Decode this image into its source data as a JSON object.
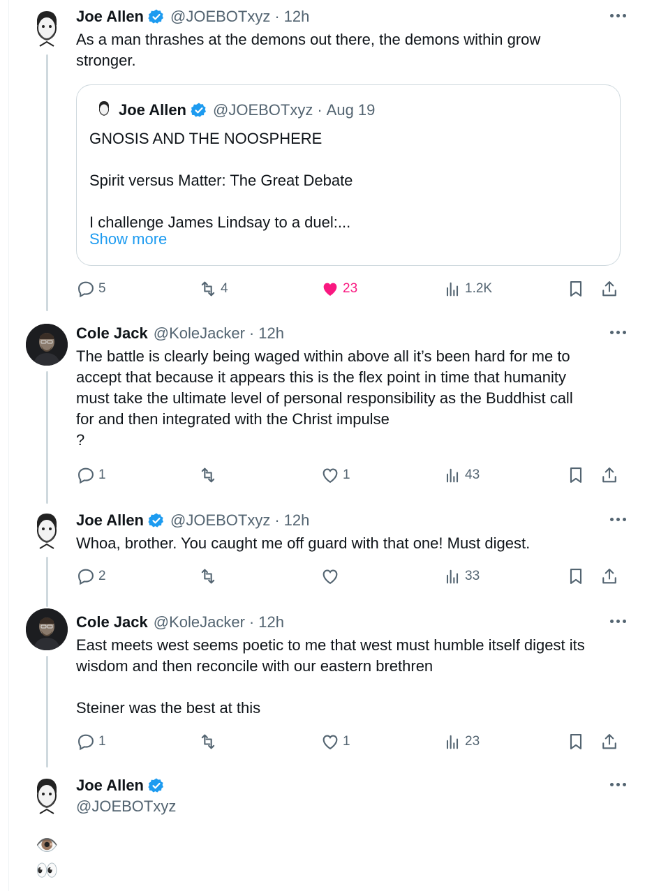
{
  "tweets": [
    {
      "name": "Joe Allen",
      "handle": "@JOEBOTxyz",
      "time": "12h",
      "text": "As a man thrashes at the demons out there, the demons within grow\nstronger.",
      "quote": {
        "name": "Joe Allen",
        "handle": "@JOEBOTxyz",
        "time": "Aug 19",
        "text": "GNOSIS AND THE NOOSPHERE\n\nSpirit versus Matter: The Great Debate\n\nI challenge James Lindsay to a duel:...",
        "show_more": "Show more"
      },
      "replies": "5",
      "reposts": "4",
      "likes": "23",
      "views": "1.2K"
    },
    {
      "name": "Cole Jack",
      "handle": "@KoleJacker",
      "time": "12h",
      "text": "The battle is clearly being waged within above all it’s been hard for me to\naccept that because it appears this is the flex point in time that humanity\nmust take the ultimate level of personal responsibility as the Buddhist call\nfor and then integrated with the Christ impulse\n?",
      "replies": "1",
      "reposts": "",
      "likes": "1",
      "views": "43"
    },
    {
      "name": "Joe Allen",
      "handle": "@JOEBOTxyz",
      "time": "12h",
      "text": "Whoa, brother. You caught me off guard with that one! Must digest.",
      "replies": "2",
      "reposts": "",
      "likes": "",
      "views": "33"
    },
    {
      "name": "Cole Jack",
      "handle": "@KoleJacker",
      "time": "12h",
      "text": "East meets west seems poetic to me that west must humble itself digest its\nwisdom and then reconcile with our eastern brethren\n\nSteiner was the best at this",
      "replies": "1",
      "reposts": "",
      "likes": "1",
      "views": "23"
    }
  ],
  "focused": {
    "name": "Joe Allen",
    "handle": "@JOEBOTxyz",
    "emoji_1": "👁️",
    "emoji_2": "👀"
  },
  "colors": {
    "accent": "#1d9bf0",
    "like": "#f91880",
    "muted": "#536471"
  }
}
